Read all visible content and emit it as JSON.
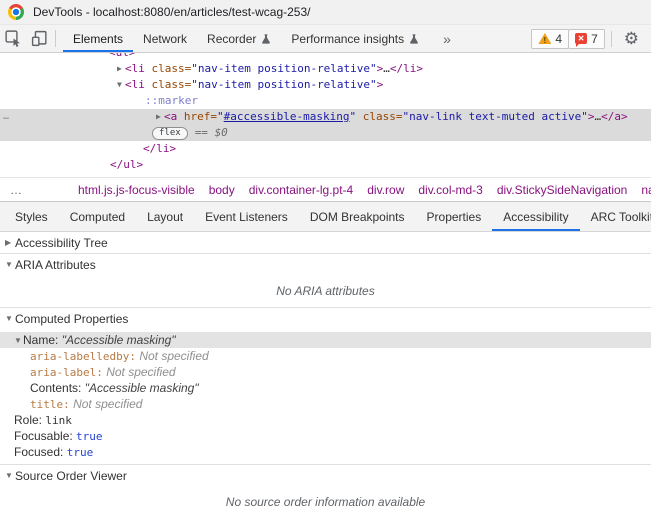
{
  "window": {
    "title": "DevTools - localhost:8080/en/articles/test-wcag-253/"
  },
  "toolbar": {
    "tabs": [
      {
        "label": "Elements",
        "active": true
      },
      {
        "label": "Network"
      },
      {
        "label": "Recorder",
        "icon": "flask-icon"
      },
      {
        "label": "Performance insights",
        "icon": "flask-icon"
      }
    ],
    "more_tabs": "»",
    "warning_count": "4",
    "error_count": "7"
  },
  "elements_tree": {
    "gutter_dots": "…",
    "rows": [
      {
        "pad": 109,
        "clipped": true,
        "tokens": [
          {
            "t": "<ul>",
            "c": "tag"
          }
        ]
      },
      {
        "pad": 117,
        "arrow": "▶",
        "tokens": [
          {
            "t": "<li",
            "c": "tag"
          },
          {
            "t": " class=",
            "c": "attr"
          },
          {
            "t": "\"nav-item position-relative\"",
            "c": "val"
          },
          {
            "t": ">",
            "c": "tag"
          },
          {
            "t": "…",
            "c": "text"
          },
          {
            "t": "</li>",
            "c": "tag"
          }
        ]
      },
      {
        "pad": 117,
        "arrow": "▼",
        "tokens": [
          {
            "t": "<li",
            "c": "tag"
          },
          {
            "t": " class=",
            "c": "attr"
          },
          {
            "t": "\"nav-item position-relative\"",
            "c": "val"
          },
          {
            "t": ">",
            "c": "tag"
          }
        ]
      },
      {
        "pad": 145,
        "tokens": [
          {
            "t": "::marker",
            "c": "pseudo"
          }
        ]
      },
      {
        "pad": 156,
        "arrow": "▶",
        "selected": true,
        "gutter": true,
        "tokens": [
          {
            "t": "<a ",
            "c": "tag"
          },
          {
            "t": "href=",
            "c": "attr"
          },
          {
            "t": "\"",
            "c": "val"
          },
          {
            "t": "#accessible-masking",
            "c": "link"
          },
          {
            "t": "\"",
            "c": "val"
          },
          {
            "t": " class=",
            "c": "attr"
          },
          {
            "t": "\"nav-link text-muted active\"",
            "c": "val"
          },
          {
            "t": ">",
            "c": "tag"
          },
          {
            "t": "…",
            "c": "text"
          },
          {
            "t": "</a>",
            "c": "tag"
          }
        ]
      },
      {
        "pad": 152,
        "selected": true,
        "badge": "flex",
        "tokens": [
          {
            "t": "== ",
            "c": "muted"
          },
          {
            "t": "$0",
            "c": "muted-i"
          }
        ]
      },
      {
        "pad": 143,
        "tokens": [
          {
            "t": "</li>",
            "c": "tag"
          }
        ]
      },
      {
        "pad": 110,
        "tokens": [
          {
            "t": "</ul>",
            "c": "tag"
          }
        ]
      }
    ]
  },
  "breadcrumbs": {
    "overflow_indicator": "…",
    "items": [
      "html.js.js-focus-visible",
      "body",
      "div.container-lg.pt-4",
      "div.row",
      "div.col-md-3",
      "div.StickySideNavigation",
      "nav#toc."
    ]
  },
  "panel_tabs": {
    "items": [
      {
        "label": "Styles"
      },
      {
        "label": "Computed"
      },
      {
        "label": "Layout"
      },
      {
        "label": "Event Listeners"
      },
      {
        "label": "DOM Breakpoints"
      },
      {
        "label": "Properties"
      },
      {
        "label": "Accessibility",
        "active": true
      },
      {
        "label": "ARC Toolkit"
      }
    ]
  },
  "accessibility": {
    "sections": [
      {
        "title": "Accessibility Tree",
        "state": "collapsed"
      },
      {
        "title": "ARIA Attributes",
        "state": "expanded",
        "empty_message": "No ARIA attributes"
      },
      {
        "title": "Computed Properties",
        "state": "expanded",
        "has_props": true
      },
      {
        "title": "Source Order Viewer",
        "state": "expanded",
        "empty_message": "No source order information available"
      }
    ],
    "computed_properties": {
      "name_row": {
        "label": "Name:",
        "value": "\"Accessible masking\"",
        "selected": true,
        "expanded": true
      },
      "name_children": [
        {
          "label": "aria-labelledby:",
          "label_style": "mono-orange",
          "value": "Not specified",
          "value_style": "unspec"
        },
        {
          "label": "aria-label:",
          "label_style": "mono-orange",
          "value": "Not specified",
          "value_style": "unspec"
        },
        {
          "label": "Contents:",
          "label_style": "sans",
          "value": "\"Accessible masking\"",
          "value_style": "string"
        },
        {
          "label": "title:",
          "label_style": "mono-orange",
          "value": "Not specified",
          "value_style": "unspec"
        }
      ],
      "rows": [
        {
          "label": "Role:",
          "value": "link",
          "value_style": "mono-dark"
        },
        {
          "label": "Focusable:",
          "value": "true",
          "value_style": "mono-blue"
        },
        {
          "label": "Focused:",
          "value": "true",
          "value_style": "mono-blue"
        }
      ]
    }
  },
  "colors": {
    "accent_blue": "#1a73e8",
    "tag": "#881280",
    "attr_name": "#994500",
    "attr_value": "#1a1aa6",
    "warning": "#f0a11c",
    "error": "#e94235"
  }
}
